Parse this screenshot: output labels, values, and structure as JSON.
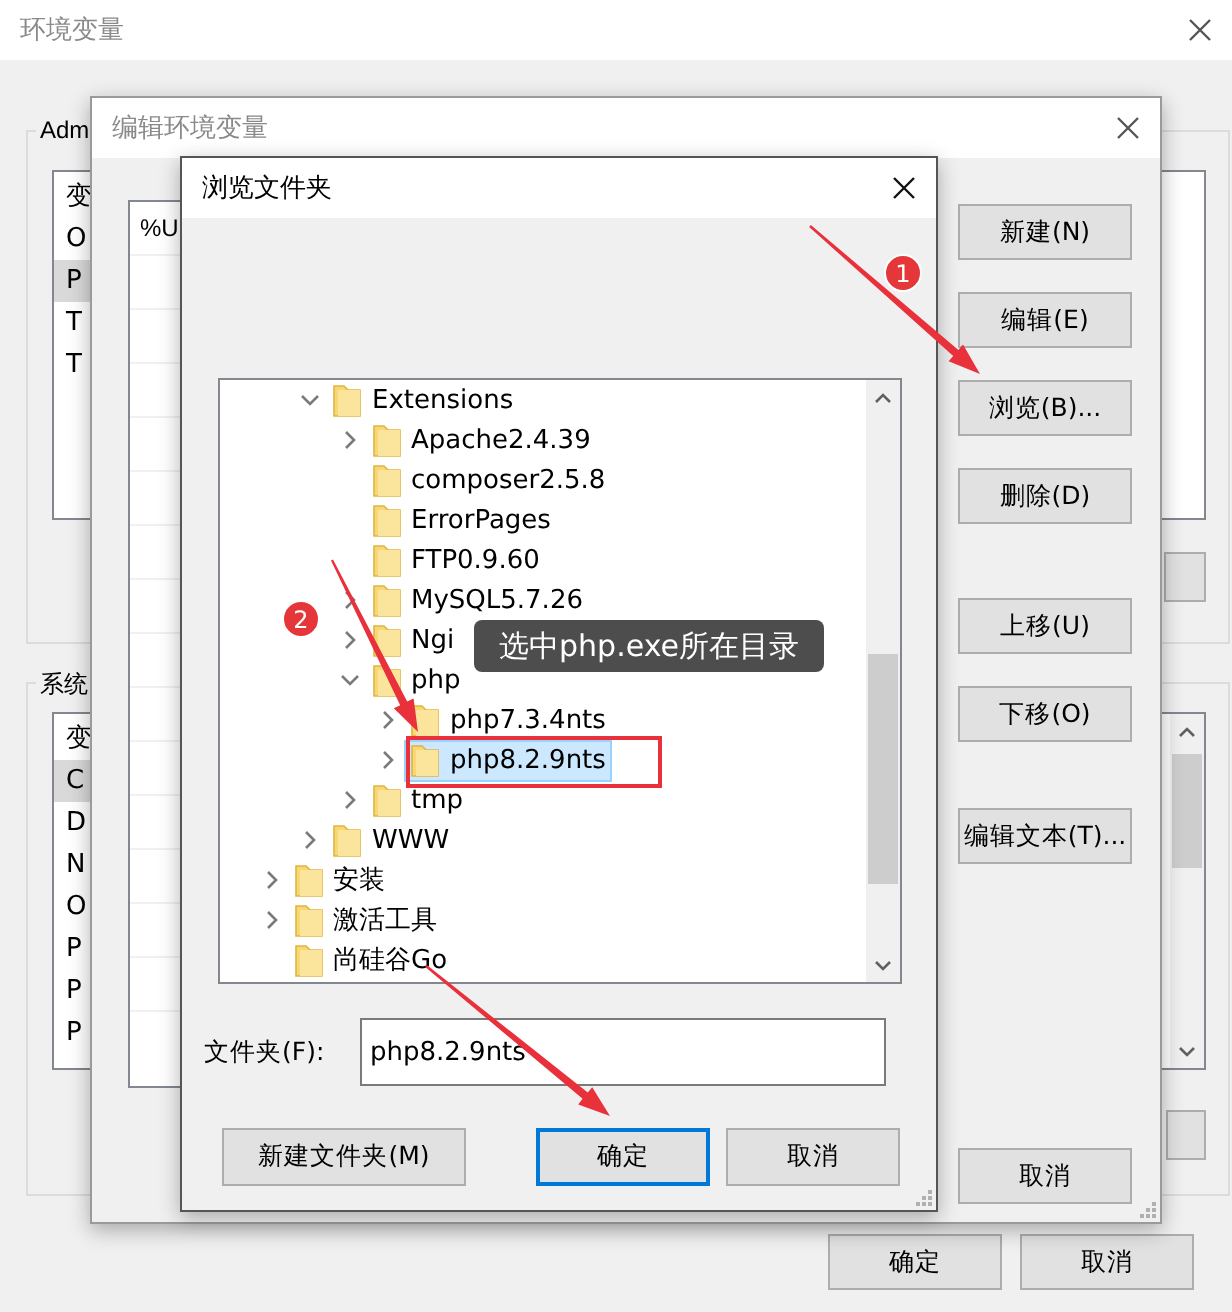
{
  "background_window": {
    "title": "环境变量",
    "user_group": {
      "title": "Adm",
      "header": "变",
      "rows": [
        {
          "name": "O",
          "selected": false
        },
        {
          "name": "P",
          "selected": true
        },
        {
          "name": "T",
          "selected": false
        },
        {
          "name": "T",
          "selected": false
        }
      ]
    },
    "system_group": {
      "title": "系统",
      "header": "变",
      "rows": [
        {
          "name": "C",
          "selected": true
        },
        {
          "name": "D",
          "selected": false
        },
        {
          "name": "N",
          "selected": false
        },
        {
          "name": "O",
          "selected": false
        },
        {
          "name": "P",
          "selected": false
        },
        {
          "name": "P",
          "selected": false
        },
        {
          "name": "P",
          "selected": false
        }
      ]
    },
    "buttons": [
      "确定",
      "取消"
    ]
  },
  "edit_window": {
    "title": "编辑环境变量",
    "list": {
      "rows": [
        "%U"
      ]
    },
    "buttons": [
      "新建(N)",
      "编辑(E)",
      "浏览(B)...",
      "删除(D)",
      "上移(U)",
      "下移(O)",
      "编辑文本(T)...",
      "取消"
    ]
  },
  "browse_dialog": {
    "title": "浏览文件夹",
    "tree": {
      "items": [
        {
          "children": [
            {
              "label": "Extensions",
              "expandable": true,
              "expanded": true,
              "selected": false,
              "children": [
                {
                  "label": "Apache2.4.39",
                  "expandable": true,
                  "expanded": false,
                  "selected": false
                },
                {
                  "label": "composer2.5.8",
                  "expandable": false,
                  "selected": false
                },
                {
                  "label": "ErrorPages",
                  "expandable": false,
                  "selected": false
                },
                {
                  "label": "FTP0.9.60",
                  "expandable": false,
                  "selected": false
                },
                {
                  "label": "MySQL5.7.26",
                  "expandable": true,
                  "expanded": false,
                  "selected": false
                },
                {
                  "label": "Ngi",
                  "expandable": true,
                  "expanded": false,
                  "selected": false
                },
                {
                  "label": "php",
                  "expandable": true,
                  "expanded": true,
                  "selected": false,
                  "children": [
                    {
                      "label": "php7.3.4nts",
                      "expandable": true,
                      "expanded": false,
                      "selected": false
                    },
                    {
                      "label": "php8.2.9nts",
                      "expandable": true,
                      "expanded": false,
                      "selected": true
                    }
                  ]
                },
                {
                  "label": "tmp",
                  "expandable": true,
                  "expanded": false,
                  "selected": false
                }
              ]
            },
            {
              "label": "WWW",
              "expandable": true,
              "expanded": false,
              "selected": false
            }
          ]
        },
        {
          "label": "安装",
          "expandable": true,
          "expanded": false,
          "selected": false
        },
        {
          "label": "激活工具",
          "expandable": true,
          "expanded": false,
          "selected": false
        },
        {
          "label": "尚硅谷Go",
          "expandable": false,
          "selected": false
        }
      ]
    },
    "folder_field": {
      "label": "文件夹(F):",
      "value": "php8.2.9nts"
    },
    "buttons": [
      {
        "label": "新建文件夹(M)",
        "default": false
      },
      {
        "label": "确定",
        "default": true
      },
      {
        "label": "取消",
        "default": false
      }
    ]
  },
  "annotations": {
    "steps": [
      {
        "number": "1"
      },
      {
        "number": "2",
        "note": "选中php.exe所在目录"
      }
    ]
  }
}
